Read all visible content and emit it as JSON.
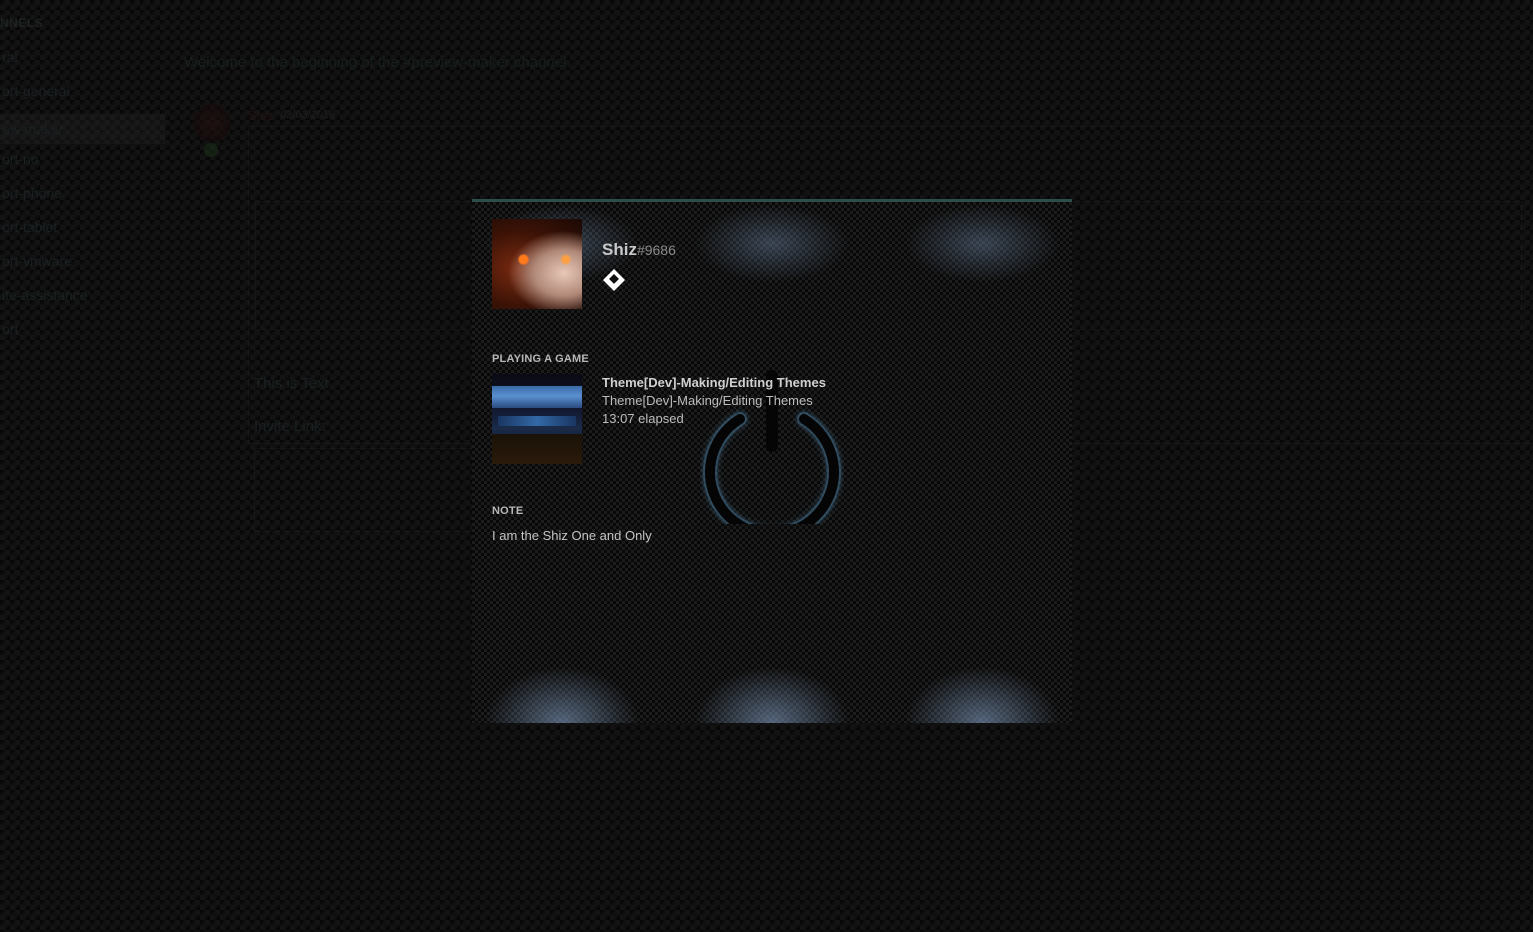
{
  "background": {
    "channels_header": "NNELS",
    "channels": [
      {
        "label": "ral",
        "active": false
      },
      {
        "label": "ort-general",
        "active": false
      },
      {
        "label": "ew-maker",
        "active": true
      },
      {
        "label": "ort-no",
        "active": false
      },
      {
        "label": "ort-phone",
        "active": false
      },
      {
        "label": "ort-tablet",
        "active": false
      },
      {
        "label": "ort-vmware",
        "active": false
      },
      {
        "label": "ite-assistance",
        "active": false
      },
      {
        "label": "ort",
        "active": false
      }
    ],
    "welcome_text": "Welcome to the beginning of the #preview-maker channel.",
    "message_author": "Shiz",
    "message_date": "02/03/2018",
    "message_text": "This is Text",
    "invite_label": "Invite Link:"
  },
  "profile": {
    "username": "Shiz",
    "discriminator": "#9686",
    "activity_label": "PLAYING A GAME",
    "game_name": "Theme[Dev]-Making/Editing Themes",
    "game_details": "Theme[Dev]-Making/Editing Themes",
    "game_elapsed": "13:07 elapsed",
    "note_label": "NOTE",
    "note_text": "I am the Shiz One and Only"
  },
  "colors": {
    "accent_border": "#2c4e4a",
    "text_primary": "#d0d0d0",
    "text_secondary": "#bdbdbd"
  },
  "icons": {
    "badge": "hypesquad-badge-icon",
    "power": "power-icon"
  }
}
